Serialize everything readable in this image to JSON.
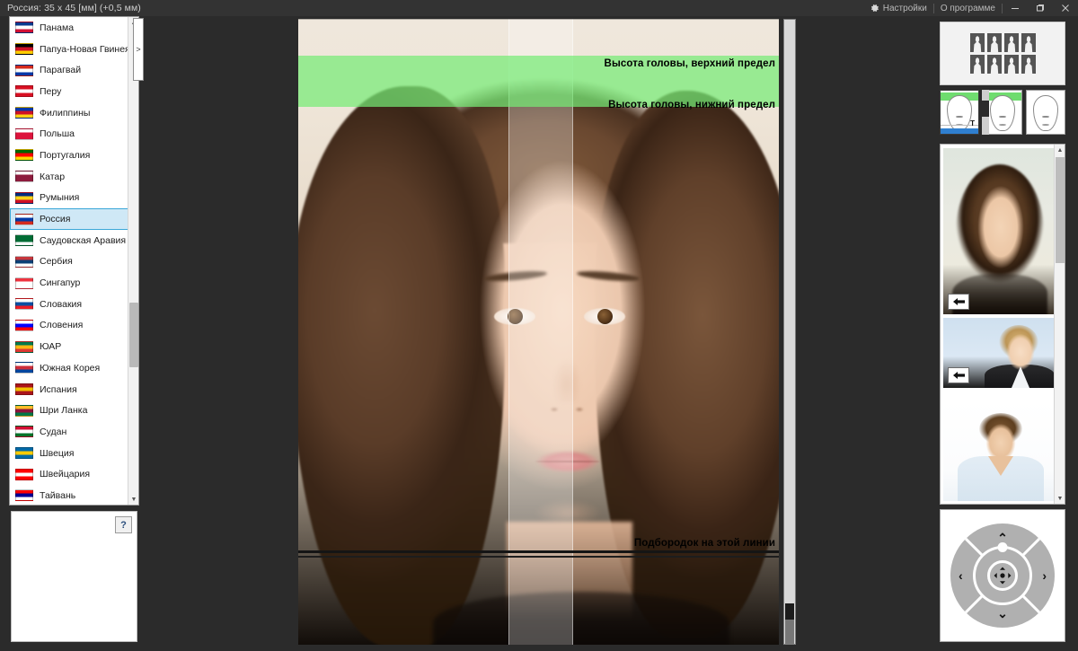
{
  "titlebar": {
    "title": "Россия: 35 x 45 [мм] (+0,5 мм)",
    "settings_label": "Настройки",
    "about_label": "О программе",
    "settings_icon": "gear-icon",
    "minimize_label": "—",
    "restore_label": "❐",
    "close_label": "✕"
  },
  "country_list": {
    "selected": "Россия",
    "items": [
      {
        "name": "Панама",
        "colors": [
          "#0a3a8f",
          "#ffffff",
          "#d21034"
        ]
      },
      {
        "name": "Папуа-Новая Гвинея",
        "colors": [
          "#000000",
          "#ce1126",
          "#ffce00"
        ]
      },
      {
        "name": "Парагвай",
        "colors": [
          "#d52b1e",
          "#ffffff",
          "#0038a8"
        ]
      },
      {
        "name": "Перу",
        "colors": [
          "#d91023",
          "#ffffff",
          "#d91023"
        ]
      },
      {
        "name": "Филиппины",
        "colors": [
          "#0038a8",
          "#ce1126",
          "#fcd116"
        ]
      },
      {
        "name": "Польша",
        "colors": [
          "#ffffff",
          "#dc143c",
          "#dc143c"
        ]
      },
      {
        "name": "Португалия",
        "colors": [
          "#006600",
          "#ff0000",
          "#ffd700"
        ]
      },
      {
        "name": "Катар",
        "colors": [
          "#ffffff",
          "#8d1b3d",
          "#8d1b3d"
        ]
      },
      {
        "name": "Румыния",
        "colors": [
          "#002b7f",
          "#fcd116",
          "#ce1126"
        ]
      },
      {
        "name": "Россия",
        "colors": [
          "#ffffff",
          "#0039a6",
          "#d52b1e"
        ]
      },
      {
        "name": "Саудовская Аравия",
        "colors": [
          "#006c35",
          "#006c35",
          "#ffffff"
        ]
      },
      {
        "name": "Сербия",
        "colors": [
          "#c6363c",
          "#0c4076",
          "#ffffff"
        ]
      },
      {
        "name": "Сингапур",
        "colors": [
          "#ef3340",
          "#ffffff",
          "#ffffff"
        ]
      },
      {
        "name": "Словакия",
        "colors": [
          "#ffffff",
          "#0b4ea2",
          "#ee1c25"
        ]
      },
      {
        "name": "Словения",
        "colors": [
          "#ffffff",
          "#0000ff",
          "#ff0000"
        ]
      },
      {
        "name": "ЮАР",
        "colors": [
          "#007a4d",
          "#ffb612",
          "#de3831"
        ]
      },
      {
        "name": "Южная Корея",
        "colors": [
          "#ffffff",
          "#cd2e3a",
          "#0047a0"
        ]
      },
      {
        "name": "Испания",
        "colors": [
          "#aa151b",
          "#f1bf00",
          "#aa151b"
        ]
      },
      {
        "name": "Шри Ланка",
        "colors": [
          "#ffbe29",
          "#8d153a",
          "#007847"
        ]
      },
      {
        "name": "Судан",
        "colors": [
          "#d21034",
          "#ffffff",
          "#007229"
        ]
      },
      {
        "name": "Швеция",
        "colors": [
          "#006aa7",
          "#fecc00",
          "#006aa7"
        ]
      },
      {
        "name": "Швейцария",
        "colors": [
          "#ff0000",
          "#ffffff",
          "#ff0000"
        ]
      },
      {
        "name": "Тайвань",
        "colors": [
          "#fe0000",
          "#000095",
          "#ffffff"
        ]
      }
    ],
    "scroll_up_icon": "triangle-up-icon",
    "scroll_down_icon": "triangle-down-icon",
    "expander_icon": "chevron-right-icon",
    "expander_label": ">"
  },
  "help_panel": {
    "help_label": "?",
    "help_icon": "question-mark-icon"
  },
  "photo_view": {
    "label_head_top": "Высота головы, верхний предел",
    "label_head_bottom": "Высота головы, нижний предел",
    "label_chin": "Подбородок на этой линии",
    "guide_band_color": "#76eb76",
    "chin_line_color": "#151515",
    "scrollbar_icon": "vertical-scrollbar"
  },
  "right_panel": {
    "sheet_preview": {
      "columns": 4,
      "rows": 2,
      "count": 8,
      "name": "print-sheet-preview"
    },
    "face_templates": [
      {
        "name": "template-with-band-and-baseline",
        "has_band": true,
        "has_blue_bar": true,
        "mark": "T",
        "selected": true
      },
      {
        "name": "template-with-band",
        "has_band": true,
        "has_blue_bar": false,
        "mark": "",
        "selected": false
      },
      {
        "name": "template-plain",
        "has_band": false,
        "has_blue_bar": false,
        "mark": "",
        "selected": false
      }
    ],
    "thumbnails": [
      {
        "name": "thumbnail-photo-1",
        "badge_icon": "arrow-left-icon"
      },
      {
        "name": "thumbnail-photo-2",
        "badge_icon": "arrow-left-icon"
      },
      {
        "name": "thumbnail-photo-3",
        "badge_icon": "arrow-left-icon"
      }
    ],
    "navpad": {
      "up": "⌃",
      "down": "⌄",
      "left": "‹",
      "right": "›",
      "center_icon": "fit-to-view-icon"
    },
    "scroll_up_icon": "triangle-up-icon",
    "scroll_down_icon": "triangle-down-icon"
  }
}
